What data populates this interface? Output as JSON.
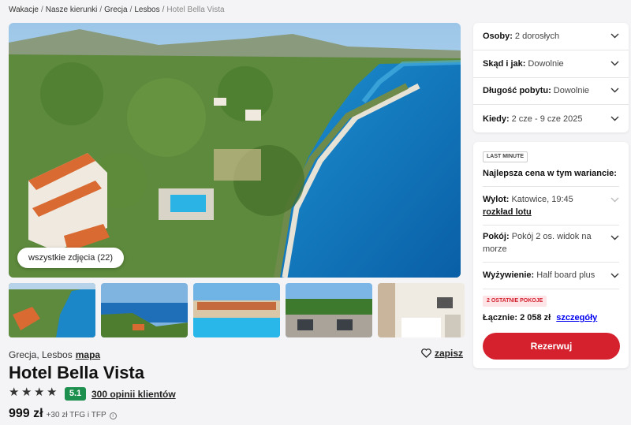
{
  "breadcrumb": {
    "items": [
      "Wakacje",
      "Nasze kierunki",
      "Grecja",
      "Lesbos"
    ],
    "current": "Hotel Bella Vista",
    "separator": "/"
  },
  "gallery": {
    "all_photos_label": "wszystkie zdjęcia (22)"
  },
  "hotel": {
    "location": "Grecja, Lesbos",
    "map_label": "mapa",
    "save_label": "zapisz",
    "name": "Hotel Bella Vista",
    "stars": 4,
    "star_glyph": "★",
    "rating": "5.1",
    "reviews_label": "300 opinii klientów",
    "price": "999 zł",
    "fees": "+30 zł TFG i TFP",
    "info_glyph": "i"
  },
  "filters": [
    {
      "label": "Osoby:",
      "value": "2 dorosłych"
    },
    {
      "label": "Skąd i jak:",
      "value": "Dowolnie"
    },
    {
      "label": "Długość pobytu:",
      "value": "Dowolnie"
    },
    {
      "label": "Kiedy:",
      "value": "2 cze - 9 cze 2025"
    }
  ],
  "offer": {
    "badge": "LAST MINUTE",
    "heading": "Najlepsza cena w tym wariancie:",
    "departure_label": "Wylot:",
    "departure_value": "Katowice, 19:45",
    "flight_schedule_link": "rozkład lotu",
    "room_label": "Pokój:",
    "room_value": "Pokój 2 os. widok na morze",
    "board_label": "Wyżywienie:",
    "board_value": "Half board plus",
    "rooms_left_badge": "2 OSTATNIE POKOJE",
    "total_label": "Łącznie:",
    "total_value": "2 058 zł",
    "details_link": "szczegóły",
    "book_label": "Rezerwuj"
  },
  "colors": {
    "accent_red": "#d5212e",
    "rating_green": "#1d8f4e",
    "rooms_badge_bg": "#fde4e6"
  }
}
